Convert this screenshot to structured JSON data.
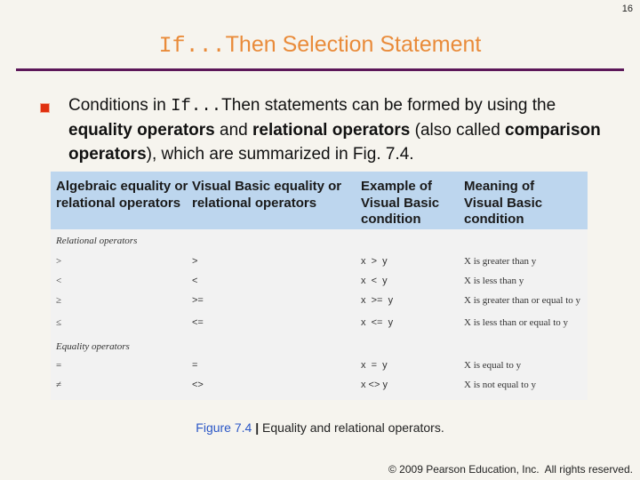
{
  "page_number": "16",
  "title": {
    "code": "If...",
    "then": "Then",
    "rest": " Selection Statement"
  },
  "bullet": {
    "part1": "Conditions in ",
    "code": "If...",
    "part2": "Then statements can be formed by using the ",
    "bold1": "equality operators",
    "part3": " and ",
    "bold2": "relational operators",
    "part4": " (also called ",
    "bold3": "comparison operators",
    "part5": "), which are summarized in Fig. 7.4."
  },
  "table": {
    "headers": [
      "Algebraic equality or relational operators",
      "Visual Basic equality or relational operators",
      "Example of Visual Basic condition",
      "Meaning of Visual Basic condition"
    ],
    "sections": [
      {
        "label": "Relational operators",
        "rows": [
          {
            "algebraic": ">",
            "vb": ">",
            "example": "x  >  y",
            "meaning": "X is greater than y"
          },
          {
            "algebraic": "<",
            "vb": "<",
            "example": "x  <  y",
            "meaning": "X is less than y"
          },
          {
            "algebraic": "≥",
            "vb": ">=",
            "example": "x  >=  y",
            "meaning": "X is greater than or equal to y"
          },
          {
            "algebraic": "≤",
            "vb": "<=",
            "example": "x  <=  y",
            "meaning": "X is less than or equal to y"
          }
        ]
      },
      {
        "label": "Equality operators",
        "rows": [
          {
            "algebraic": "=",
            "vb": "=",
            "example": "x  =  y",
            "meaning": "X is equal to y"
          },
          {
            "algebraic": "≠",
            "vb": "<>",
            "example": "x <> y",
            "meaning": "X is not equal to y"
          }
        ]
      }
    ]
  },
  "caption": {
    "figure": "Figure 7.4",
    "separator": " | ",
    "text": "Equality and relational operators."
  },
  "footer": "© 2009 Pearson Education, Inc.  All rights reserved."
}
